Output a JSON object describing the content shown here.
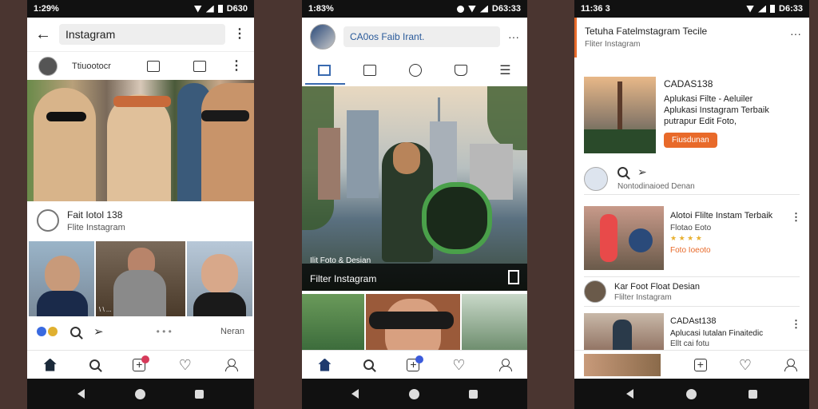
{
  "phone1": {
    "status": {
      "time": "1:29%"
    },
    "header": {
      "title": "Instagram"
    },
    "profile_row": {
      "name": "Ttiuootocr"
    },
    "post": {
      "title": "Fait Iotol 138",
      "subtitle": "Flite Instagram"
    },
    "grid": {
      "caption": "\\  \\  ..."
    },
    "actions": {
      "more_label": "Neran"
    }
  },
  "phone2": {
    "status": {
      "time": "1:83%",
      "right": "D63:33"
    },
    "header": {
      "title": "CA0os Faib Irant."
    },
    "post": {
      "tag": "Ilit Foto & Desian",
      "caption": "Filter Instagram"
    }
  },
  "phone3": {
    "status": {
      "time": "11:36 3",
      "right": "D6:33"
    },
    "header": {
      "title": "Tetuha Fatelmstagram Tecile",
      "subtitle": "Fliter Instagram"
    },
    "feature": {
      "title": "CADAS138",
      "desc_1": "Aplukasi Filte - Aeluiler",
      "desc_2": "Aplukasi Instagram Terbaik",
      "desc_3": "putrapur Edit Foto,",
      "button": "Fiusdunan",
      "meta": "Nontodinaioed Denan"
    },
    "list": [
      {
        "title": "Alotoi Flilte Instam Terbaik",
        "sub": "Flotao Eoto",
        "accent": "Foto Ioeoto"
      },
      {
        "title": "Kar Foot Float Desian",
        "sub": "Flilter Instagram"
      },
      {
        "title": "CADAst138",
        "sub": "Aplucasi Iutalan Finaitedic",
        "accent": "Ellt cai fotu"
      }
    ]
  },
  "colors": {
    "accent_orange": "#e86a2a",
    "nav_blue": "#1e3a6e",
    "badge_pink": "#d63a5a"
  }
}
